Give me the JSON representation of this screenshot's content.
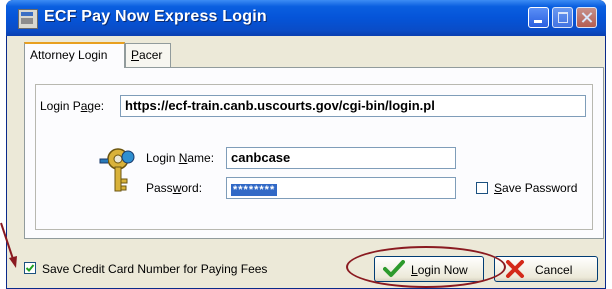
{
  "window": {
    "title": "ECF Pay Now Express Login"
  },
  "tabs": [
    {
      "label": "Attorney Login",
      "active": true
    },
    {
      "label_prefix": "",
      "label_hot": "P",
      "label_rest": "acer",
      "active": false
    }
  ],
  "login_page": {
    "label_prefix": "Login P",
    "label_hot": "a",
    "label_rest": "ge:",
    "value": "https://ecf-train.canb.uscourts.gov/cgi-bin/login.pl"
  },
  "login_name": {
    "label_prefix": "Login ",
    "label_hot": "N",
    "label_rest": "ame:",
    "value": "canbcase"
  },
  "password": {
    "label_prefix": "Pass",
    "label_hot": "w",
    "label_rest": "ord:",
    "value": "********"
  },
  "save_password": {
    "label_prefix": "",
    "label_hot": "S",
    "label_rest": "ave Password",
    "checked": false
  },
  "save_credit_card": {
    "label": "Save Credit Card Number for Paying Fees",
    "checked": true
  },
  "buttons": {
    "login_now": {
      "label_prefix": "",
      "label_hot": "L",
      "label_rest": "ogin Now",
      "icon": "green-check-icon"
    },
    "cancel": {
      "label": "Cancel",
      "icon": "red-x-icon"
    }
  },
  "icons": {
    "key": "key-icon",
    "app": "app-icon"
  },
  "colors": {
    "titlebar": "#0554d8",
    "selection": "#3169c6",
    "highlight_oval": "#8a1a20"
  }
}
